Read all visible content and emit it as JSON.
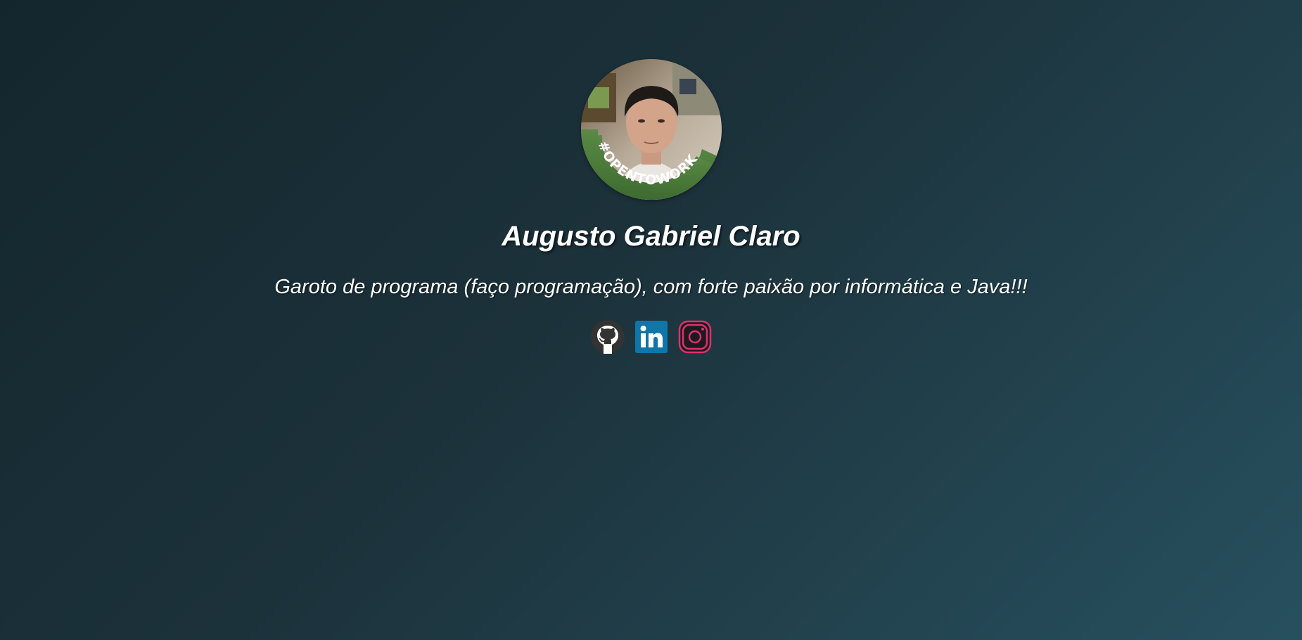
{
  "profile": {
    "name": "Augusto Gabriel Claro",
    "bio": "Garoto de programa (faço programação), com forte paixão por informática e Java!!!",
    "avatar_badge": "#OPENTOWORK"
  },
  "socials": [
    {
      "icon": "github-icon",
      "color": "#333333"
    },
    {
      "icon": "linkedin-icon",
      "color": "#0e76a8"
    },
    {
      "icon": "instagram-icon",
      "color": "#e1306c"
    }
  ],
  "colors": {
    "background_start": "#14262d",
    "background_end": "#27505f",
    "badge_green": "#4a7a3c"
  }
}
